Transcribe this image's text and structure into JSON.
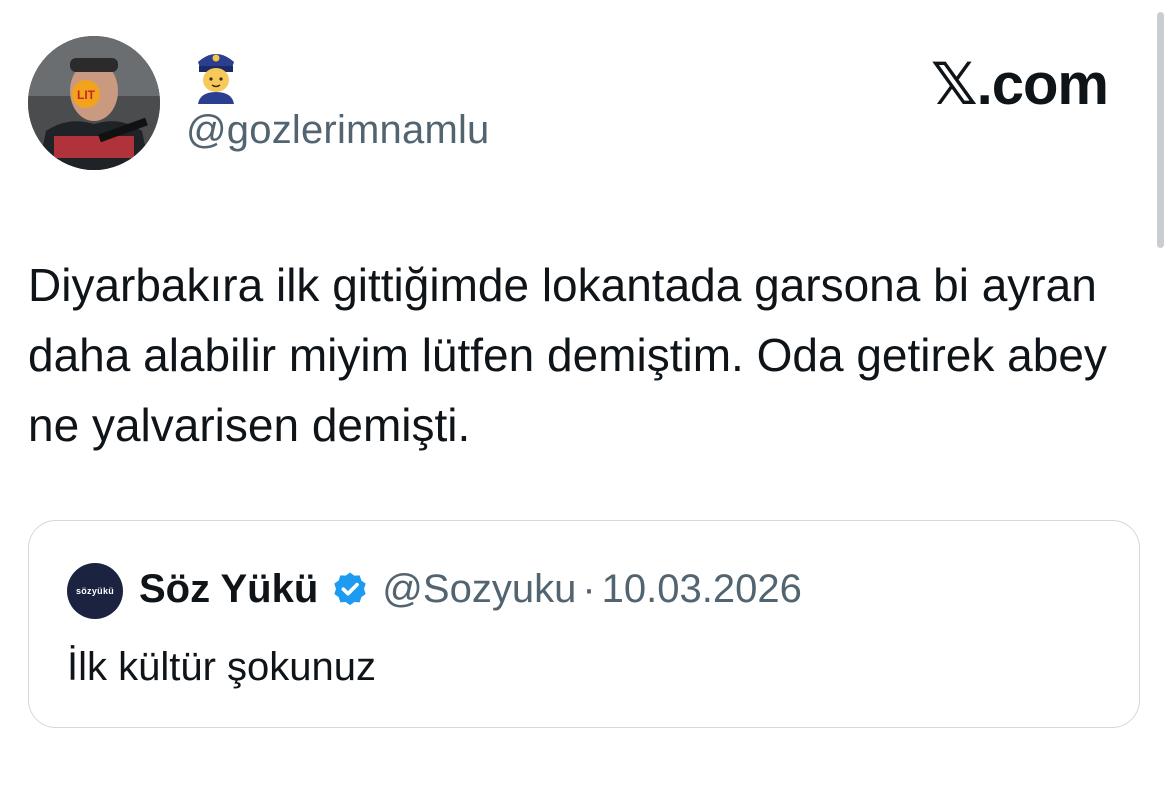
{
  "author": {
    "handle": "@gozlerimnamlu",
    "emoji_icon": "police-officer-emoji",
    "avatar_badge": "LIT"
  },
  "brand": {
    "label": "𝕏.com"
  },
  "tweet": {
    "text": "Diyarbakıra ilk gittiğimde lokantada garsona bi ayran daha alabilir miyim lütfen demiştim. Oda getirek abey ne yalvarisen demişti."
  },
  "quote": {
    "avatar_label": "sözyükü",
    "name": "Söz Yükü",
    "handle": "@Sozyuku",
    "separator": "·",
    "date": "10.03.2026",
    "text": "İlk kültür şokunuz",
    "verified_color": "#1d9bf0"
  },
  "colors": {
    "text_primary": "#0f1419",
    "text_secondary": "#536471",
    "border": "#cfd9de"
  }
}
